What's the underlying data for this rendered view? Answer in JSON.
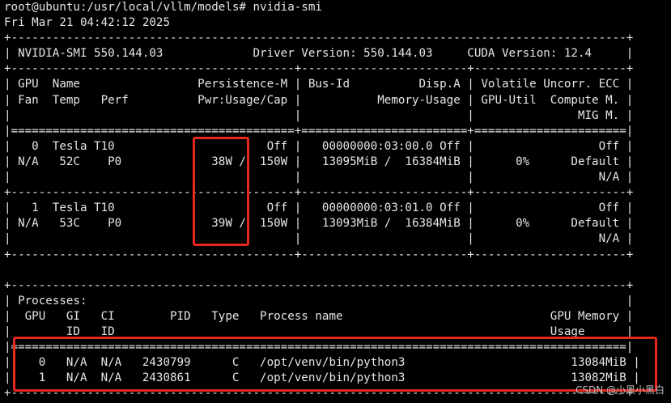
{
  "terminal": {
    "prompt": "root@ubuntu:/usr/local/vllm/models# nvidia-smi",
    "timestamp": "Fri Mar 21 04:42:12 2025",
    "header_version_line": "| NVIDIA-SMI 550.144.03             Driver Version: 550.144.03     CUDA Version: 12.4     |",
    "gpu_table": {
      "border_top": "+-----------------------------------------------------------------------------------------+",
      "col_headers": [
        "| GPU  Name                 Persistence-M | Bus-Id          Disp.A | Volatile Uncorr. ECC |",
        "| Fan  Temp   Perf          Pwr:Usage/Cap |           Memory-Usage | GPU-Util  Compute M. |",
        "|                                         |                        |               MIG M. |"
      ],
      "header_sep": "|=========================================+========================+======================|",
      "row_sep": "+-----------------------------------------+------------------------+----------------------+",
      "gpus": [
        {
          "line1": "|   0  Tesla T10                      Off |   00000000:03:00.0 Off |                  Off |",
          "line2": "| N/A   52C    P0             38W /  150W |   13095MiB /  16384MiB |      0%      Default |",
          "line3": "|                                         |                        |                  N/A |"
        },
        {
          "line1": "|   1  Tesla T10                      Off |   00000000:03:01.0 Off |                  Off |",
          "line2": "| N/A   53C    P0             39W /  150W |   13093MiB /  16384MiB |      0%      Default |",
          "line3": "|                                         |                        |                  N/A |"
        }
      ]
    },
    "processes_table": {
      "border_top": "+-----------------------------------------------------------------------------------------+",
      "title": "| Processes:                                                                              |",
      "col_headers": [
        "|  GPU   GI   CI        PID   Type   Process name                              GPU Memory |",
        "|        ID   ID                                                               Usage      |"
      ],
      "header_sep": "|=========================================================================================|",
      "rows": [
        "|    0   N/A  N/A   2430799      C   /opt/venv/bin/python3                        13084MiB |",
        "|    1   N/A  N/A   2430861      C   /opt/venv/bin/python3                        13082MiB |"
      ],
      "border_bottom": "+-----------------------------------------------------------------------------------------+"
    }
  },
  "annotation_color": "#e8271f",
  "watermark": "CSDN @小黑小黑白"
}
